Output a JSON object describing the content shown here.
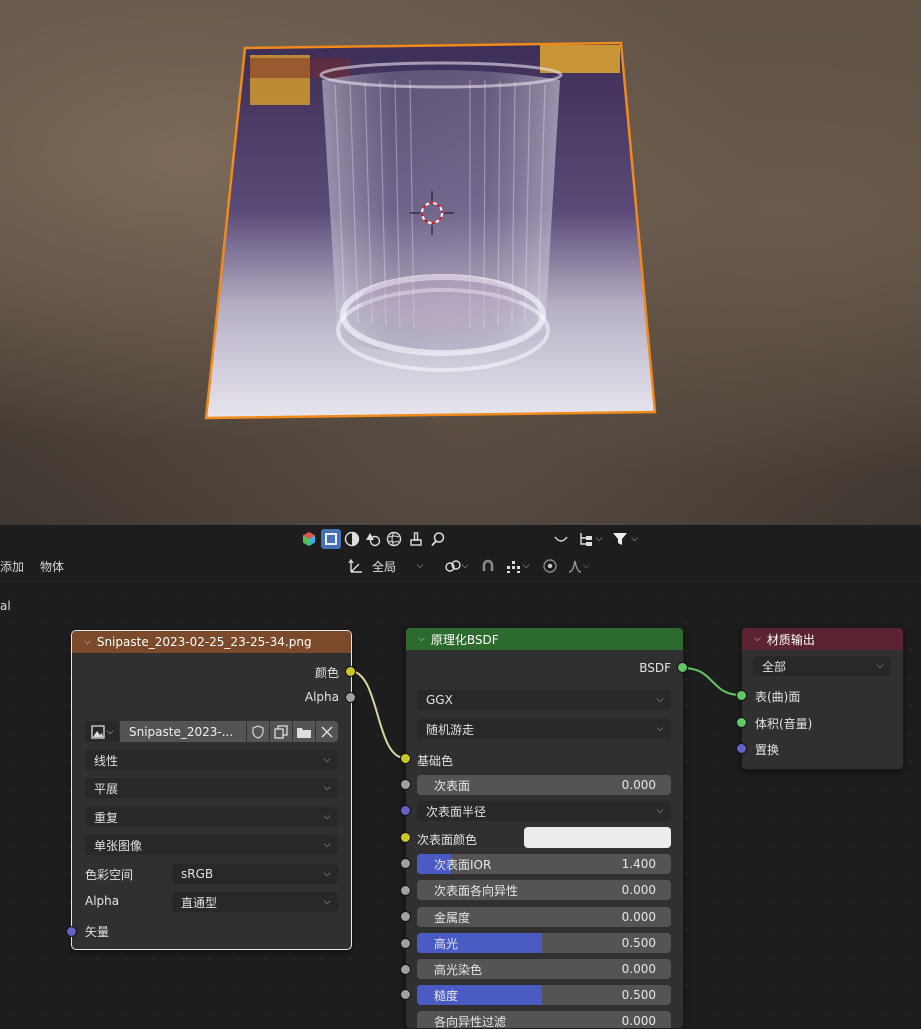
{
  "header": {
    "menu_add": "添加",
    "menu_object": "物体",
    "slot_fragment": "al",
    "transform_space": "全局"
  },
  "image_node": {
    "title": "Snipaste_2023-02-25_23-25-34.png",
    "out_color": "颜色",
    "out_alpha": "Alpha",
    "image_name": "Snipaste_2023-...",
    "interpolation": "线性",
    "projection": "平展",
    "extension": "重复",
    "source": "单张图像",
    "colorspace_label": "色彩空间",
    "colorspace_value": "sRGB",
    "alpha_label": "Alpha",
    "alpha_value": "直通型",
    "in_vector": "矢量",
    "header_color": "#7a4a2a"
  },
  "bsdf_node": {
    "title": "原理化BSDF",
    "out_bsdf": "BSDF",
    "distribution": "GGX",
    "subsurface_method": "随机游走",
    "base_color": "基础色",
    "header_color": "#2d6a2d",
    "params": [
      {
        "label": "次表面",
        "value": "0.000",
        "fill": 0
      },
      {
        "label": "次表面半径",
        "value": "",
        "fill": 0
      },
      {
        "label": "次表面颜色",
        "value": "",
        "fill": 0
      },
      {
        "label": "次表面IOR",
        "value": "1.400",
        "fill": 0.14
      },
      {
        "label": "次表面各向异性",
        "value": "0.000",
        "fill": 0
      },
      {
        "label": "金属度",
        "value": "0.000",
        "fill": 0
      },
      {
        "label": "高光",
        "value": "0.500",
        "fill": 0.5
      },
      {
        "label": "高光染色",
        "value": "0.000",
        "fill": 0
      },
      {
        "label": "糙度",
        "value": "0.500",
        "fill": 0.5
      },
      {
        "label": "各向异性过滤",
        "value": "0.000",
        "fill": 0
      }
    ]
  },
  "output_node": {
    "title": "材质输出",
    "target": "全部",
    "in_surface": "表(曲)面",
    "in_volume": "体积(音量)",
    "in_displacement": "置换",
    "header_color": "#5a2530"
  }
}
